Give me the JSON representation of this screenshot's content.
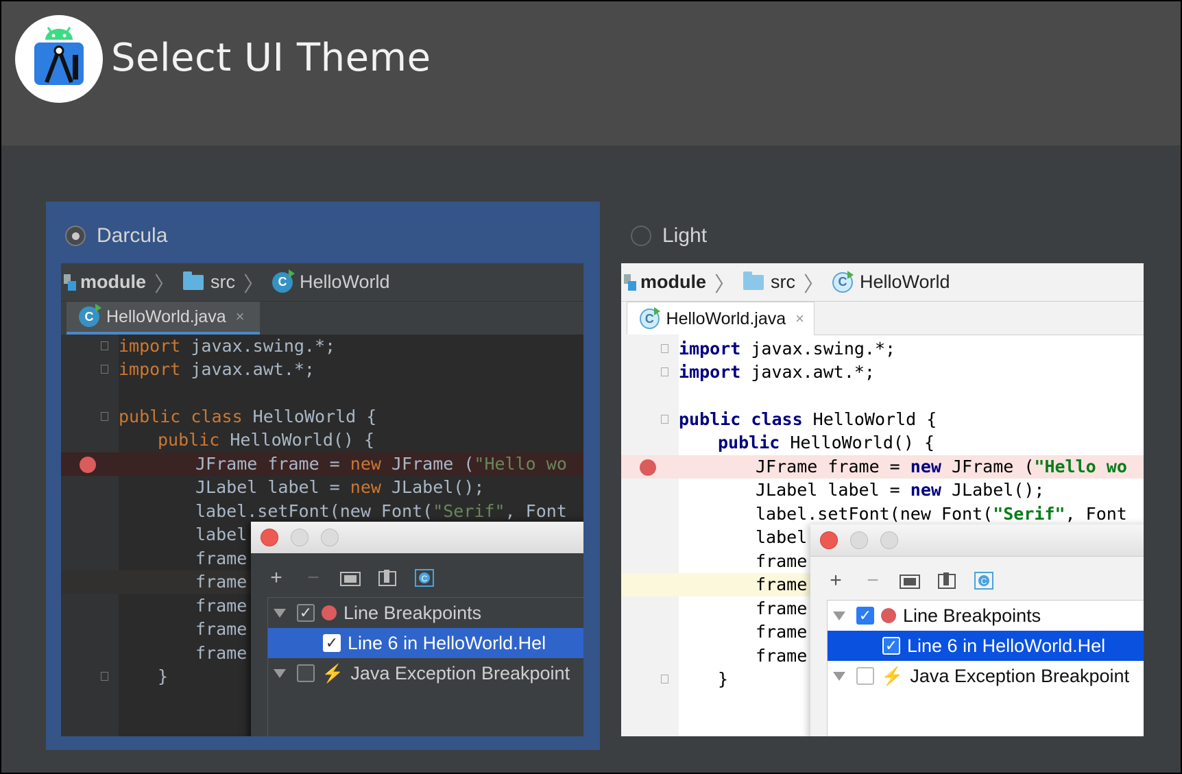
{
  "header": {
    "title": "Select UI Theme",
    "logo": "android-studio-logo"
  },
  "themes": [
    {
      "name": "Darcula",
      "selected": true
    },
    {
      "name": "Light",
      "selected": false
    }
  ],
  "preview": {
    "breadcrumb": {
      "module": "module",
      "src": "src",
      "class": "HelloWorld"
    },
    "tab": {
      "label": "HelloWorld.java",
      "close": "×"
    },
    "code": {
      "l1": {
        "kw": "import",
        "rest": " javax.swing.*;"
      },
      "l2": {
        "kw": "import",
        "rest": " javax.awt.*;"
      },
      "l3": {
        "kw": "public class",
        "rest": " HelloWorld {"
      },
      "l4": {
        "kw": "public",
        "rest": " HelloWorld() {"
      },
      "l5": {
        "a": "JFrame frame = ",
        "kw": "new",
        "b": " JFrame (",
        "str": "\"Hello wo"
      },
      "l6": {
        "a": "JLabel label = ",
        "kw": "new",
        "b": " JLabel();"
      },
      "l7": {
        "a": "label.setFont(new Font(",
        "str": "\"Serif\"",
        "b": ", Font"
      },
      "l8": "label.",
      "l9": "frame.",
      "l10": "frame.",
      "l11": "frame.",
      "l12": "frame.",
      "l13": "frame.",
      "l14": "}"
    },
    "dialog": {
      "toolbar": {
        "add": "+",
        "remove": "−"
      },
      "rows": {
        "line_breakpoints": "Line Breakpoints",
        "line6": "Line 6 in HelloWorld.Hel",
        "java_exception": "Java Exception Breakpoint"
      },
      "check": "✓"
    }
  }
}
